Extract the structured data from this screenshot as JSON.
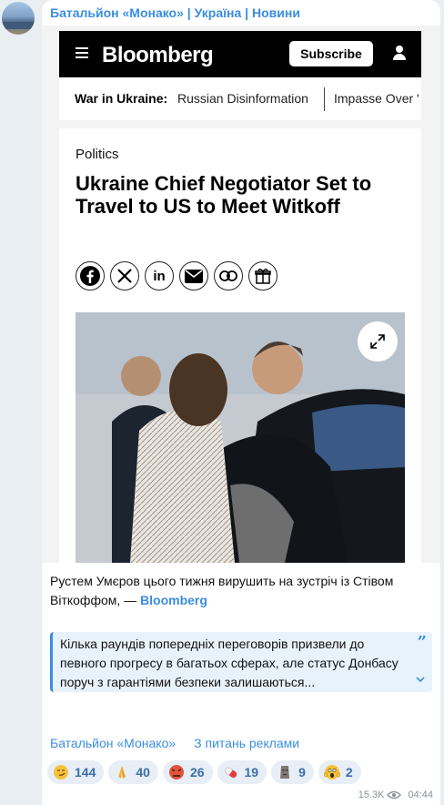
{
  "channel": {
    "name": "Батальйон «Монако» | Україна | Новини"
  },
  "article_screenshot": {
    "header": {
      "logo": "Bloomberg",
      "subscribe_label": "Subscribe"
    },
    "nav": {
      "label": "War in Ukraine:",
      "items": [
        "Russian Disinformation",
        "Impasse Over '"
      ]
    },
    "category": "Politics",
    "title": "Ukraine Chief Negotiator Set to Travel to US to Meet Witkoff",
    "share_icons": [
      "facebook-icon",
      "x-icon",
      "linkedin-icon",
      "email-icon",
      "link-icon",
      "gift-icon"
    ]
  },
  "caption": {
    "text": "Рустем Умєров цього тижня вирушить на зустріч із Стівом Віткоффом, — ",
    "link": "Bloomberg"
  },
  "quote": {
    "text": "Кілька раундів попередніх переговорів призвели до певного прогресу в багатьох сферах, але статус Донбасу поруч з гарантіями безпеки залишаються..."
  },
  "footer_links": [
    "Батальйон «Монако»",
    "З питань реклами"
  ],
  "reactions": [
    {
      "emoji": "smirk-emoji",
      "count": "144"
    },
    {
      "emoji": "pray-emoji",
      "count": "40"
    },
    {
      "emoji": "angry-emoji",
      "count": "26"
    },
    {
      "emoji": "pill-emoji",
      "count": "19"
    },
    {
      "emoji": "moai-emoji",
      "count": "9"
    },
    {
      "emoji": "scream-emoji",
      "count": "2"
    }
  ],
  "meta": {
    "views": "15.3K",
    "time": "04:44"
  },
  "colors": {
    "accent": "#3a8ee0",
    "reaction_bg": "#e7eef6",
    "quote_bg": "#e8f2fb"
  }
}
